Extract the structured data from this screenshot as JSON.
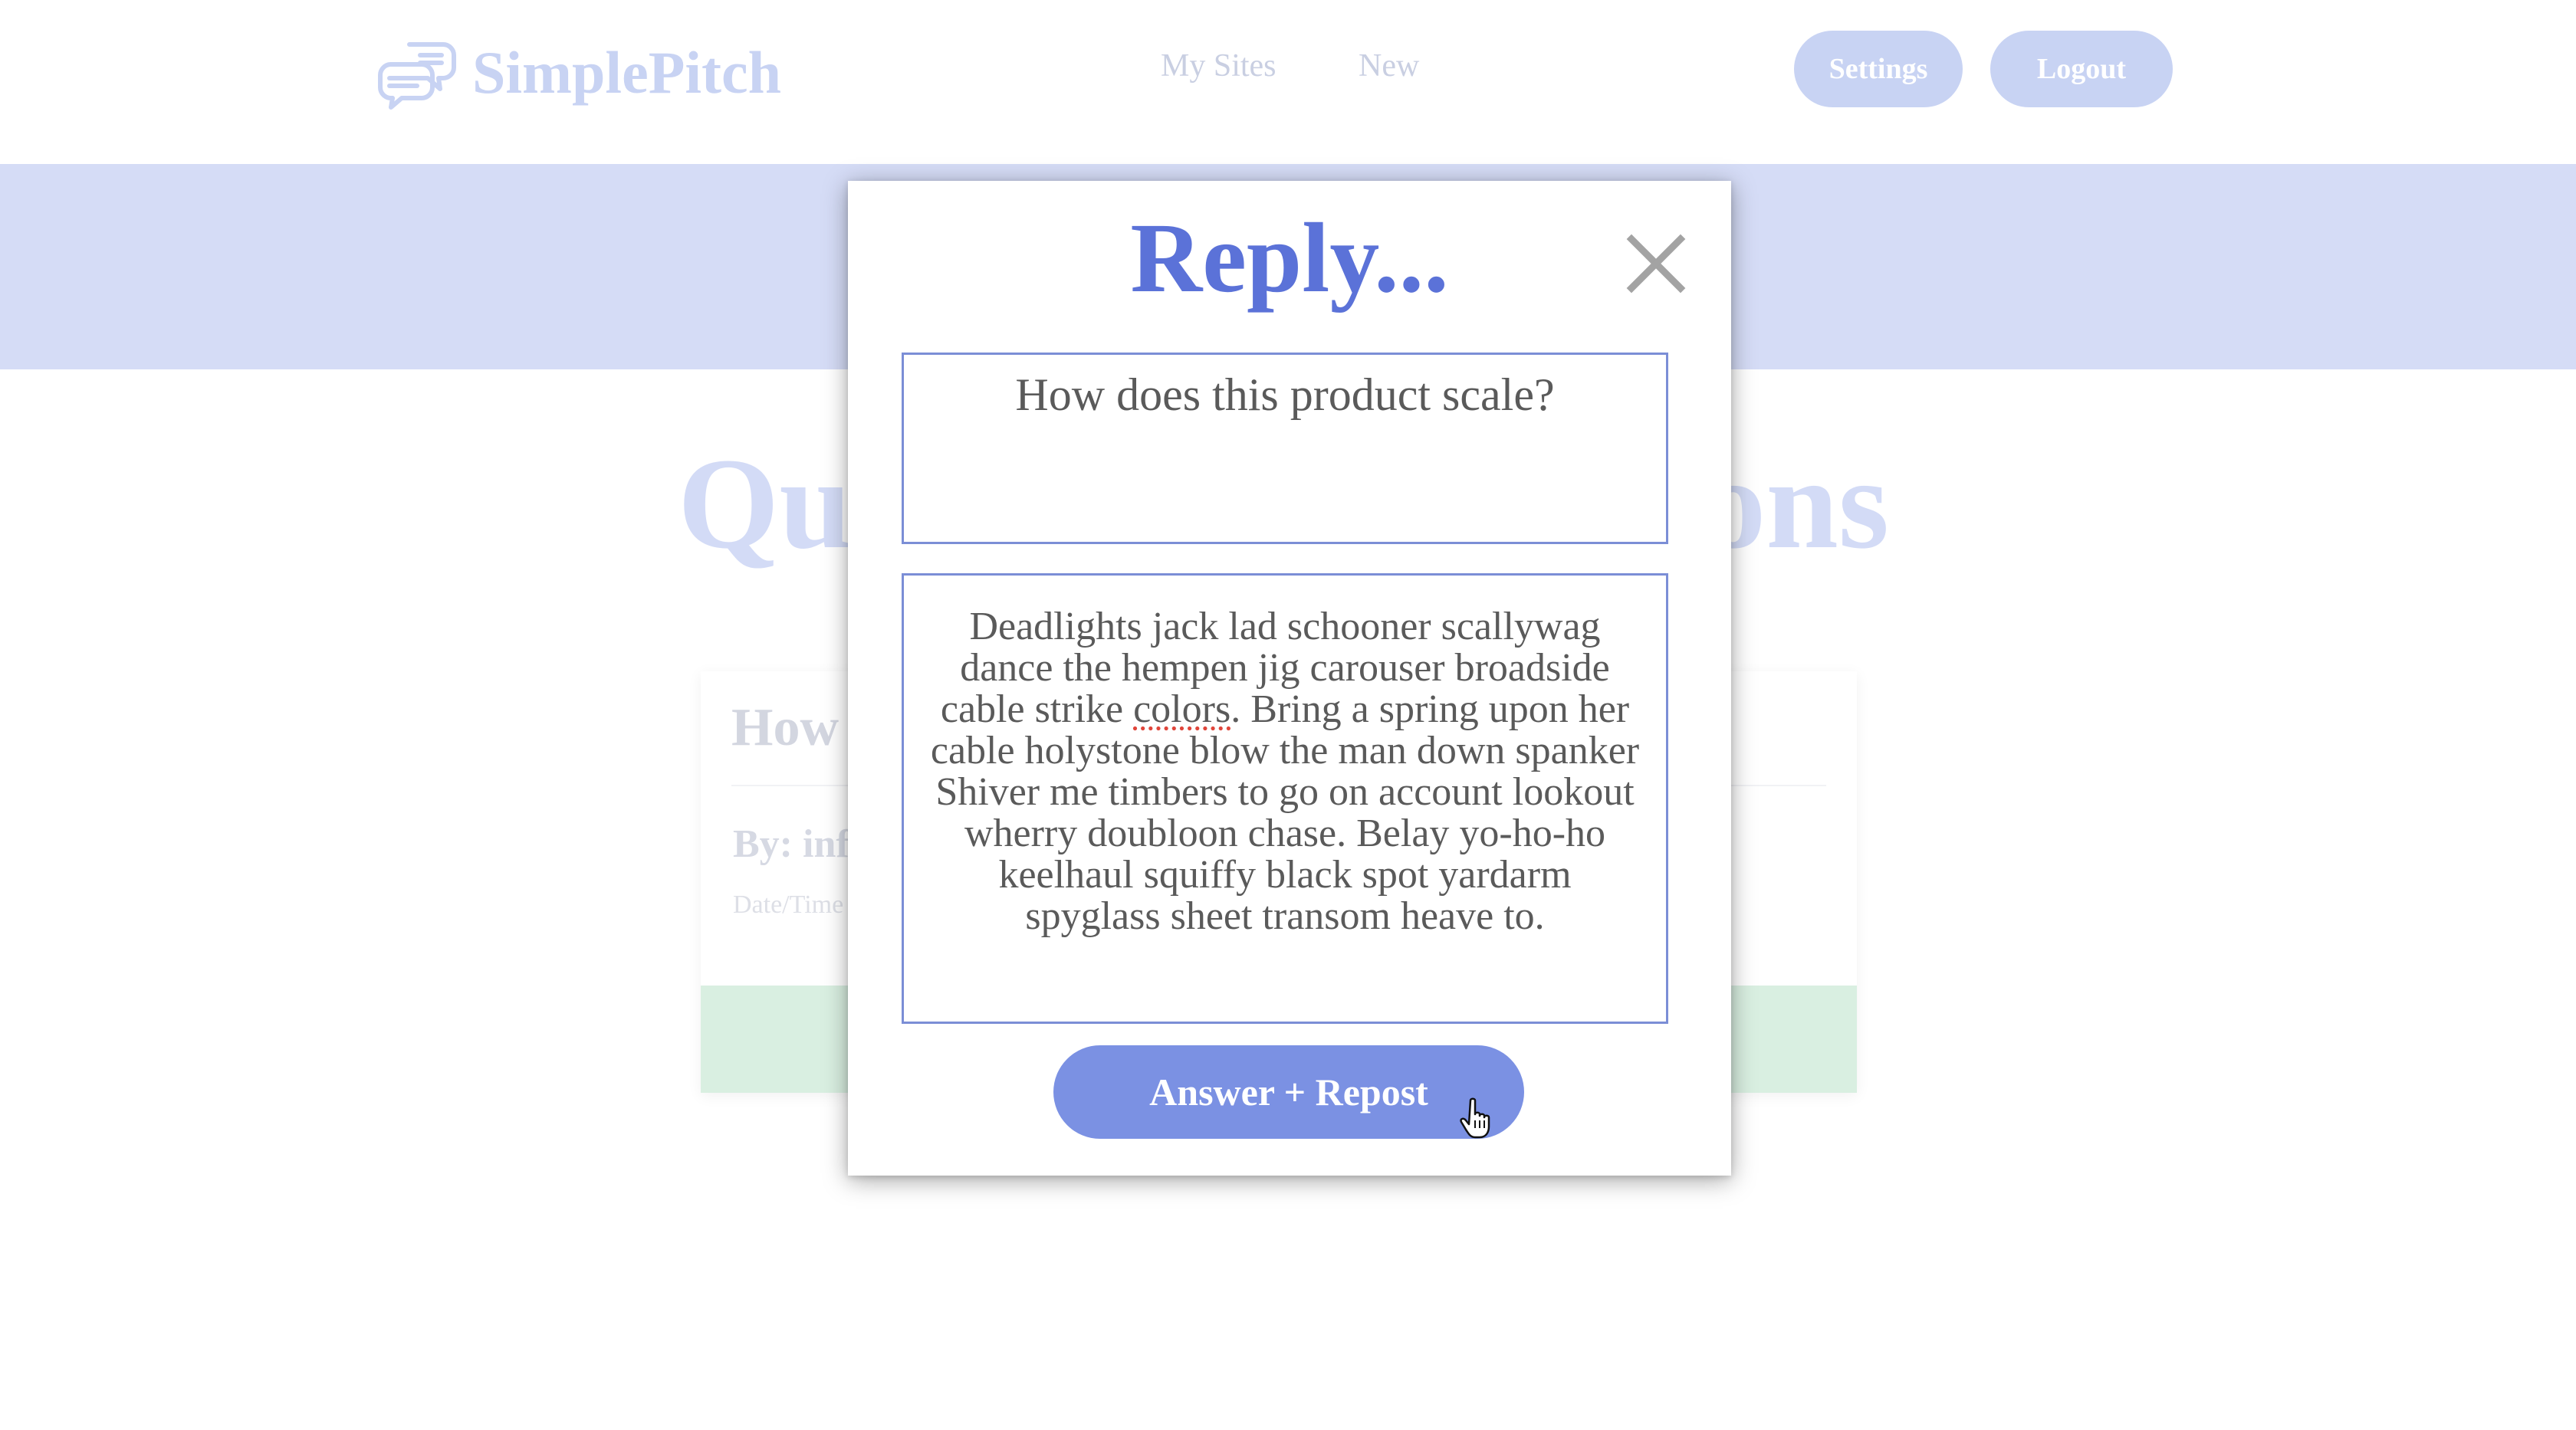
{
  "header": {
    "brand": "SimplePitch",
    "nav": {
      "my_sites": "My Sites",
      "new": "New"
    },
    "settings_label": "Settings",
    "logout_label": "Logout"
  },
  "background": {
    "page_title_left": "Qu",
    "page_title_right": "ons",
    "card": {
      "title_fragment": "How",
      "author_fragment": "By: inf",
      "date_fragment": "Date/Time"
    }
  },
  "modal": {
    "title": "Reply...",
    "question": "How does this product scale?",
    "answer_before": "Deadlights jack lad schooner scallywag dance the hempen jig carouser broadside cable strike ",
    "answer_misspelled": "colors",
    "answer_after": ". Bring a spring upon her cable holystone blow the man down spanker Shiver me timbers to go on account lookout wherry doubloon chase. Belay yo-ho-ho keelhaul squiffy black spot yardarm spyglass sheet transom heave to.",
    "submit_label": "Answer + Repost"
  },
  "colors": {
    "accent": "#5b72d8",
    "button": "#7b91e3",
    "band": "#d5dcf6",
    "card_footer": "#d9efe1"
  },
  "icons": {
    "logo": "chat-bubbles-icon",
    "close": "close-icon",
    "cursor": "hand-pointer-cursor-icon"
  }
}
